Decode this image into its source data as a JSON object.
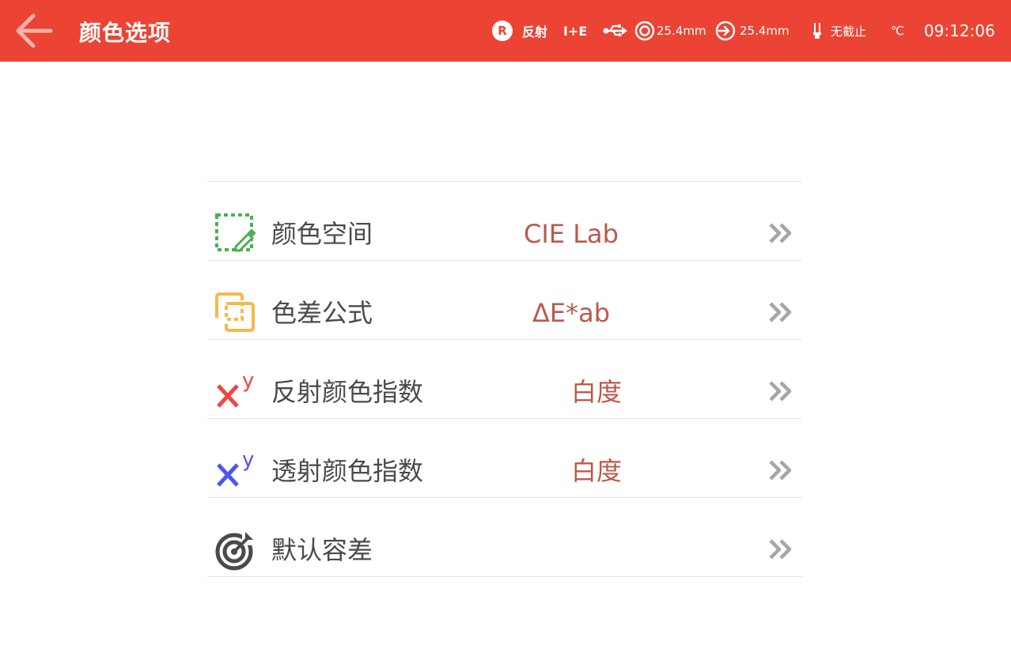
{
  "header": {
    "title": "颜色选项",
    "mode_badge": "R",
    "mode_label": "反射",
    "measure_mode": "I+E",
    "aperture_value": "25.4mm",
    "aperture2_value": "25.4mm",
    "uv_label": "无截止",
    "temp_unit": "℃",
    "time": "09:12:06"
  },
  "icons": {
    "back": "arrow-left-icon",
    "usb": "usb-icon",
    "aperture": "aperture-icon",
    "lens": "lens-icon",
    "lamp": "lamp-icon",
    "color_space": "color-picker-icon",
    "delta_e": "overlap-squares-icon",
    "refl_index": "xy-index-icon",
    "trans_index": "xy-index-icon",
    "tolerance": "target-icon",
    "chevron": "double-chevron-right-icon"
  },
  "colors": {
    "header_bg": "#ec4434",
    "value_text": "#b85a4e",
    "label_text": "#4a4a4a",
    "chevron": "#a6a6a6",
    "icon_green": "#4caf50",
    "icon_yellow": "#f7b84b",
    "icon_red": "#f04545",
    "icon_blue": "#4f55f2",
    "icon_dark": "#4a4a4a"
  },
  "menu": {
    "items": [
      {
        "label": "颜色空间",
        "value": "CIE Lab"
      },
      {
        "label": "色差公式",
        "value": "ΔE*ab"
      },
      {
        "label": "反射颜色指数",
        "value": "白度"
      },
      {
        "label": "透射颜色指数",
        "value": "白度"
      },
      {
        "label": "默认容差",
        "value": ""
      }
    ]
  },
  "icon_glyphs": {
    "sup_y": "y"
  }
}
